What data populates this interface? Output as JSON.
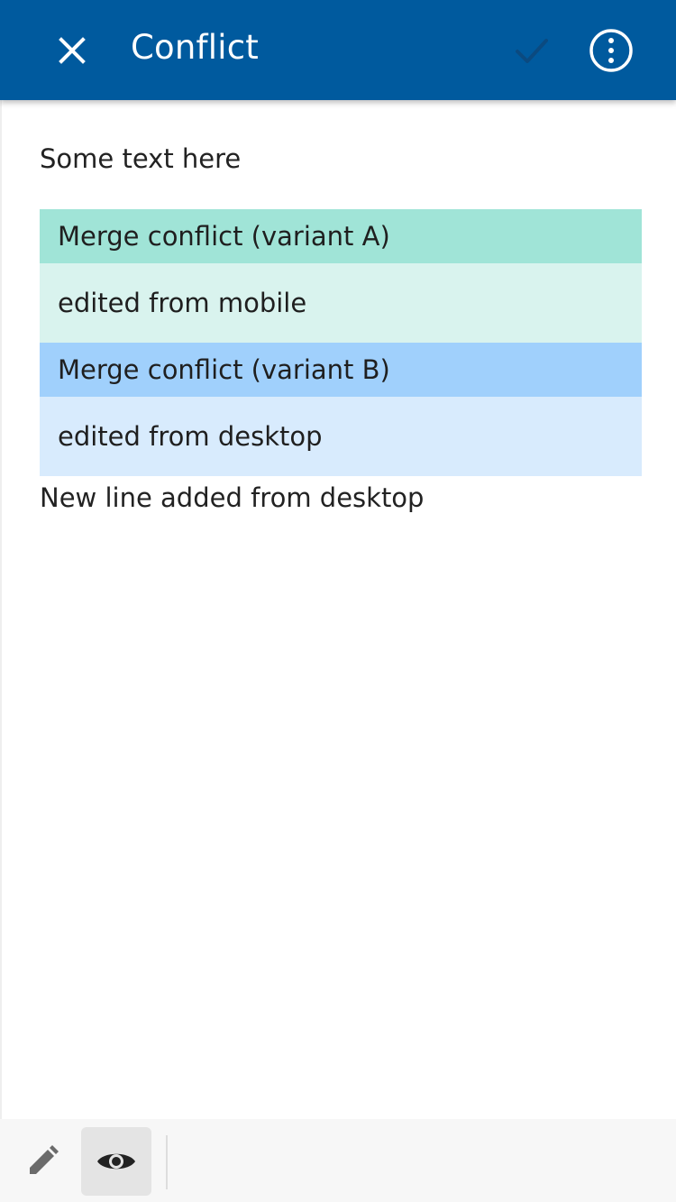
{
  "header": {
    "title": "Conflict",
    "background": "#005a9e",
    "icons": [
      "close-icon",
      "check-icon",
      "more-vert-icon"
    ]
  },
  "content": {
    "intro_line": "Some text here",
    "conflicts": [
      {
        "header": "Merge conflict (variant A)",
        "body": "edited from mobile",
        "header_color": "#a0e4d7",
        "body_color": "#d9f3ee"
      },
      {
        "header": "Merge conflict (variant B)",
        "body": "edited from desktop",
        "header_color": "#a0d0fc",
        "body_color": "#d8ebfd"
      }
    ],
    "trailing_line": "New line added from desktop"
  },
  "toolbar": {
    "buttons": [
      {
        "icon": "pencil-icon",
        "selected": false
      },
      {
        "icon": "eye-icon",
        "selected": true
      }
    ]
  }
}
